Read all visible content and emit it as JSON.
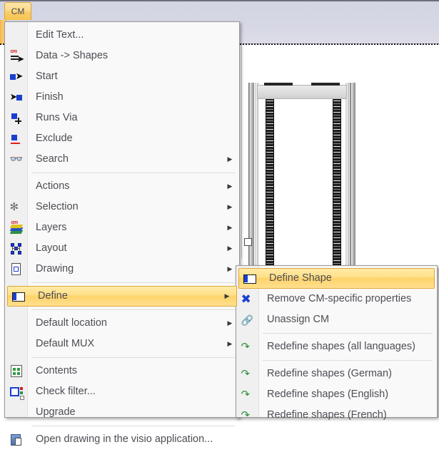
{
  "ribbon": {
    "tab_label": "CM"
  },
  "context_menu": {
    "items": [
      {
        "label": "Edit Text...",
        "icon": "none",
        "arrow": false,
        "sep_after": false,
        "highlight": false
      },
      {
        "label": "Data -> Shapes",
        "icon": "cm-data-shapes-icon",
        "arrow": false,
        "sep_after": false,
        "highlight": false
      },
      {
        "label": "Start",
        "icon": "start-icon",
        "arrow": false,
        "sep_after": false,
        "highlight": false
      },
      {
        "label": "Finish",
        "icon": "finish-icon",
        "arrow": false,
        "sep_after": false,
        "highlight": false
      },
      {
        "label": "Runs Via",
        "icon": "runs-via-icon",
        "arrow": false,
        "sep_after": false,
        "highlight": false
      },
      {
        "label": "Exclude",
        "icon": "exclude-icon",
        "arrow": false,
        "sep_after": false,
        "highlight": false
      },
      {
        "label": "Search",
        "icon": "binoculars-icon",
        "arrow": true,
        "sep_after": true,
        "highlight": false
      },
      {
        "label": "Actions",
        "icon": "none",
        "arrow": true,
        "sep_after": false,
        "highlight": false
      },
      {
        "label": "Selection",
        "icon": "selection-icon",
        "arrow": true,
        "sep_after": false,
        "highlight": false
      },
      {
        "label": "Layers",
        "icon": "layers-icon",
        "arrow": true,
        "sep_after": false,
        "highlight": false
      },
      {
        "label": "Layout",
        "icon": "layout-icon",
        "arrow": true,
        "sep_after": false,
        "highlight": false
      },
      {
        "label": "Drawing",
        "icon": "drawing-icon",
        "arrow": true,
        "sep_after": true,
        "highlight": false
      },
      {
        "label": "Define",
        "icon": "define-icon",
        "arrow": true,
        "sep_after": true,
        "highlight": true
      },
      {
        "label": "Default location",
        "icon": "none",
        "arrow": true,
        "sep_after": false,
        "highlight": false
      },
      {
        "label": "Default MUX",
        "icon": "none",
        "arrow": true,
        "sep_after": true,
        "highlight": false
      },
      {
        "label": "Contents",
        "icon": "contents-icon",
        "arrow": false,
        "sep_after": false,
        "highlight": false
      },
      {
        "label": "Check filter...",
        "icon": "check-filter-icon",
        "arrow": false,
        "sep_after": false,
        "highlight": false
      },
      {
        "label": "Upgrade",
        "icon": "none",
        "arrow": false,
        "sep_after": true,
        "highlight": false
      },
      {
        "label": "Open drawing in the visio application...",
        "icon": "visio-icon",
        "arrow": false,
        "sep_after": false,
        "highlight": false
      }
    ]
  },
  "define_submenu": {
    "items": [
      {
        "label": "Define Shape",
        "icon": "define-icon",
        "sep_after": false,
        "highlight": true
      },
      {
        "label": "Remove CM-specific properties",
        "icon": "remove-x-icon",
        "sep_after": false,
        "highlight": false
      },
      {
        "label": "Unassign CM",
        "icon": "unassign-icon",
        "sep_after": true,
        "highlight": false
      },
      {
        "label": "Redefine shapes (all languages)",
        "icon": "redo-icon",
        "sep_after": true,
        "highlight": false
      },
      {
        "label": "Redefine shapes (German)",
        "icon": "redo-icon",
        "sep_after": false,
        "highlight": false
      },
      {
        "label": "Redefine shapes (English)",
        "icon": "redo-icon",
        "sep_after": false,
        "highlight": false
      },
      {
        "label": "Redefine shapes (French)",
        "icon": "redo-icon",
        "sep_after": false,
        "highlight": false
      }
    ]
  },
  "canvas": {
    "shape_name": "server-rack-shape"
  },
  "colors": {
    "ribbon": "#d5d6e3",
    "highlight_gold": "#ffd978",
    "highlight_border": "#e2a63a",
    "menu_background": "#f9f9f9",
    "gutter": "#f0f0f0",
    "text": "#4d4d55",
    "accent_blue": "#1a3fd0",
    "accent_green": "#2f8f3f",
    "accent_red": "#d02020"
  }
}
